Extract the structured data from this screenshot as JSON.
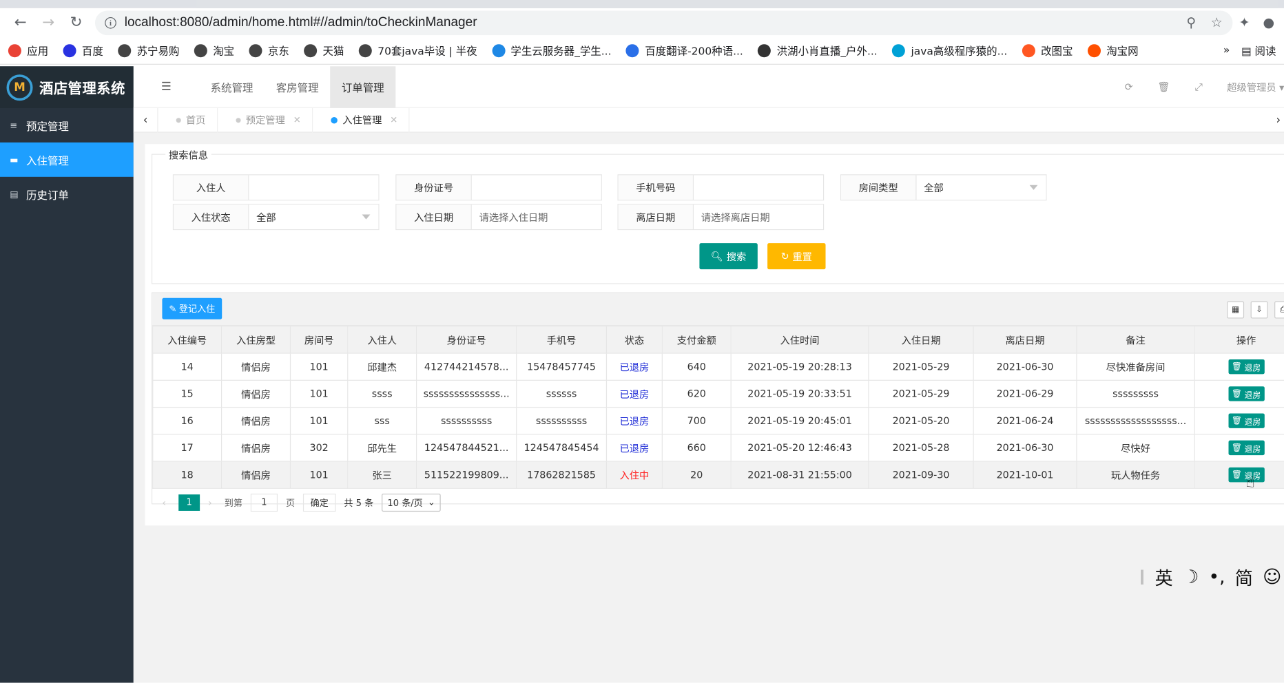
{
  "browser": {
    "url": "localhost:8080/admin/home.html#//admin/toCheckinManager",
    "bookmarks": [
      {
        "label": "应用",
        "color": "#e94235"
      },
      {
        "label": "百度",
        "color": "#2932e1"
      },
      {
        "label": "苏宁易购",
        "color": "#444"
      },
      {
        "label": "淘宝",
        "color": "#444"
      },
      {
        "label": "京东",
        "color": "#444"
      },
      {
        "label": "天猫",
        "color": "#444"
      },
      {
        "label": "70套java毕设 | 半夜",
        "color": "#444"
      },
      {
        "label": "学生云服务器_学生...",
        "color": "#1e88e5"
      },
      {
        "label": "百度翻译-200种语...",
        "color": "#2a6fe8"
      },
      {
        "label": "洪湖小肖直播_户外...",
        "color": "#333"
      },
      {
        "label": "java高级程序猿的...",
        "color": "#00a1d6"
      },
      {
        "label": "改图宝",
        "color": "#ff5722"
      },
      {
        "label": "淘宝网",
        "color": "#ff5000"
      }
    ],
    "more": "»",
    "reading_list": "阅读"
  },
  "app": {
    "title": "酒店管理系统",
    "logo_letter": "M",
    "menu": [
      {
        "label": "预定管理",
        "active": false
      },
      {
        "label": "入住管理",
        "active": true
      },
      {
        "label": "历史订单",
        "active": false
      }
    ],
    "top_nav": [
      {
        "label": "系统管理",
        "active": false
      },
      {
        "label": "客房管理",
        "active": false
      },
      {
        "label": "订单管理",
        "active": true
      }
    ],
    "admin": "超级管理员",
    "tabs": [
      {
        "label": "首页",
        "closable": false,
        "active": false
      },
      {
        "label": "预定管理",
        "closable": true,
        "active": false
      },
      {
        "label": "入住管理",
        "closable": true,
        "active": true
      }
    ]
  },
  "search": {
    "legend": "搜索信息",
    "fields": {
      "guest": {
        "label": "入住人",
        "value": ""
      },
      "idcard": {
        "label": "身份证号",
        "value": ""
      },
      "phone": {
        "label": "手机号码",
        "value": ""
      },
      "roomtype": {
        "label": "房间类型",
        "value": "全部"
      },
      "status": {
        "label": "入住状态",
        "value": "全部"
      },
      "checkin": {
        "label": "入住日期",
        "placeholder": "请选择入住日期"
      },
      "checkout": {
        "label": "离店日期",
        "placeholder": "请选择离店日期"
      }
    },
    "search_btn": "搜索",
    "reset_btn": "重置"
  },
  "table": {
    "add_btn": "登记入住",
    "columns": [
      "入住编号",
      "入住房型",
      "房间号",
      "入住人",
      "身份证号",
      "手机号",
      "状态",
      "支付金额",
      "入住时间",
      "入住日期",
      "离店日期",
      "备注",
      "操作"
    ],
    "rows": [
      {
        "id": "14",
        "type": "情侣房",
        "room": "101",
        "guest": "邱建杰",
        "idcard": "412744214578...",
        "phone": "15478457745",
        "status": "已退房",
        "amount": "640",
        "time": "2021-05-19 20:28:13",
        "in": "2021-05-29",
        "out": "2021-06-30",
        "note": "尽快准备房间",
        "action": "退房"
      },
      {
        "id": "15",
        "type": "情侣房",
        "room": "101",
        "guest": "ssss",
        "idcard": "sssssssssssssss...",
        "phone": "ssssss",
        "status": "已退房",
        "amount": "620",
        "time": "2021-05-19 20:33:51",
        "in": "2021-05-29",
        "out": "2021-06-29",
        "note": "sssssssss",
        "action": "退房"
      },
      {
        "id": "16",
        "type": "情侣房",
        "room": "101",
        "guest": "sss",
        "idcard": "ssssssssss",
        "phone": "ssssssssss",
        "status": "已退房",
        "amount": "700",
        "time": "2021-05-19 20:45:01",
        "in": "2021-05-20",
        "out": "2021-06-24",
        "note": "ssssssssssssssssss...",
        "action": "退房"
      },
      {
        "id": "17",
        "type": "情侣房",
        "room": "302",
        "guest": "邱先生",
        "idcard": "124547844521...",
        "phone": "124547845454",
        "status": "已退房",
        "amount": "660",
        "time": "2021-05-20 12:46:43",
        "in": "2021-05-28",
        "out": "2021-06-30",
        "note": "尽快好",
        "action": "退房"
      },
      {
        "id": "18",
        "type": "情侣房",
        "room": "101",
        "guest": "张三",
        "idcard": "511522199809...",
        "phone": "17862821585",
        "status": "入住中",
        "amount": "20",
        "time": "2021-08-31 21:55:00",
        "in": "2021-09-30",
        "out": "2021-10-01",
        "note": "玩人物任务",
        "action": "退房"
      }
    ],
    "pager": {
      "current": "1",
      "goto": "到第",
      "page_input": "1",
      "page_unit": "页",
      "ok": "确定",
      "total": "共 5 条",
      "size": "10 条/页"
    }
  },
  "ime": {
    "lang": "英",
    "moon": "☽",
    "punct": "•,",
    "simp": "简",
    "emoji": "☺"
  }
}
